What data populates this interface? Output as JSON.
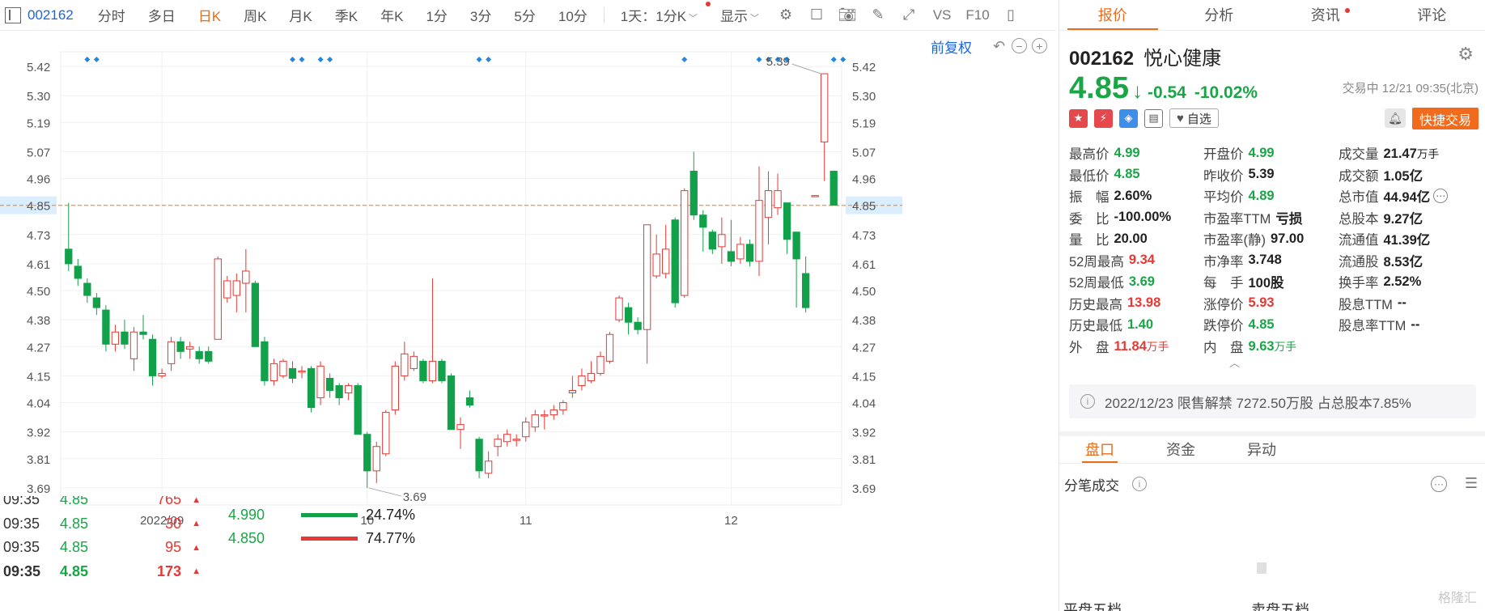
{
  "toolbar": {
    "code": "002162",
    "periods": [
      "分时",
      "多日",
      "日K",
      "周K",
      "月K",
      "季K",
      "年K",
      "1分",
      "3分",
      "5分",
      "10分"
    ],
    "active_period": "日K",
    "interval_label": "1天：1分K",
    "display_label": "显示",
    "vs_label": "VS",
    "f10_label": "F10"
  },
  "chart": {
    "adjust_label": "前复权",
    "current_price_label": "4.85",
    "max_label": "5.39",
    "min_label": "3.69",
    "x_labels": [
      "2022/09",
      "10",
      "11",
      "12"
    ],
    "y_ticks": [
      5.42,
      5.3,
      5.19,
      5.07,
      4.96,
      4.85,
      4.73,
      4.61,
      4.5,
      4.38,
      4.27,
      4.15,
      4.04,
      3.92,
      3.81,
      3.69
    ],
    "y_tick_labels": [
      "5.42",
      "5.30",
      "5.19",
      "5.07",
      "4.96",
      "4.85",
      "4.73",
      "4.61",
      "4.50",
      "4.38",
      "4.27",
      "4.15",
      "4.04",
      "3.92",
      "3.81",
      "3.69"
    ],
    "colors": {
      "up": "#e53935",
      "down": "#12a14a",
      "marker": "#1e88e5",
      "price_line": "#f59a5a"
    }
  },
  "chart_data": {
    "type": "candlestick",
    "title": "",
    "xlabel": "",
    "ylabel": "",
    "ylim": [
      3.62,
      5.48
    ],
    "x": [
      "2022/09",
      "10",
      "11",
      "12"
    ],
    "candles": [
      {
        "o": 4.67,
        "c": 4.61,
        "h": 4.86,
        "l": 4.58
      },
      {
        "o": 4.6,
        "c": 4.55,
        "h": 4.63,
        "l": 4.52
      },
      {
        "o": 4.53,
        "c": 4.48,
        "h": 4.55,
        "l": 4.45
      },
      {
        "o": 4.47,
        "c": 4.43,
        "h": 4.49,
        "l": 4.4
      },
      {
        "o": 4.42,
        "c": 4.28,
        "h": 4.44,
        "l": 4.25
      },
      {
        "o": 4.28,
        "c": 4.33,
        "h": 4.36,
        "l": 4.25
      },
      {
        "o": 4.33,
        "c": 4.28,
        "h": 4.38,
        "l": 4.26
      },
      {
        "o": 4.22,
        "c": 4.33,
        "h": 4.35,
        "l": 4.17
      },
      {
        "o": 4.33,
        "c": 4.32,
        "h": 4.4,
        "l": 4.3
      },
      {
        "o": 4.3,
        "c": 4.15,
        "h": 4.32,
        "l": 4.11
      },
      {
        "o": 4.15,
        "c": 4.16,
        "h": 4.18,
        "l": 4.14
      },
      {
        "o": 4.2,
        "c": 4.29,
        "h": 4.31,
        "l": 4.17
      },
      {
        "o": 4.29,
        "c": 4.25,
        "h": 4.31,
        "l": 4.22
      },
      {
        "o": 4.26,
        "c": 4.27,
        "h": 4.29,
        "l": 4.22
      },
      {
        "o": 4.25,
        "c": 4.22,
        "h": 4.27,
        "l": 4.2
      },
      {
        "o": 4.25,
        "c": 4.21,
        "h": 4.27,
        "l": 4.2
      },
      {
        "o": 4.3,
        "c": 4.63,
        "h": 4.64,
        "l": 4.3
      },
      {
        "o": 4.47,
        "c": 4.54,
        "h": 4.56,
        "l": 4.45
      },
      {
        "o": 4.48,
        "c": 4.54,
        "h": 4.57,
        "l": 4.41
      },
      {
        "o": 4.53,
        "c": 4.58,
        "h": 4.67,
        "l": 4.41
      },
      {
        "o": 4.53,
        "c": 4.27,
        "h": 4.54,
        "l": 4.27
      },
      {
        "o": 4.29,
        "c": 4.13,
        "h": 4.31,
        "l": 4.11
      },
      {
        "o": 4.13,
        "c": 4.2,
        "h": 4.22,
        "l": 4.11
      },
      {
        "o": 4.15,
        "c": 4.21,
        "h": 4.22,
        "l": 4.14
      },
      {
        "o": 4.18,
        "c": 4.14,
        "h": 4.21,
        "l": 4.12
      },
      {
        "o": 4.17,
        "c": 4.17,
        "h": 4.19,
        "l": 4.14
      },
      {
        "o": 4.18,
        "c": 4.02,
        "h": 4.19,
        "l": 4.0
      },
      {
        "o": 4.06,
        "c": 4.19,
        "h": 4.21,
        "l": 4.03
      },
      {
        "o": 4.14,
        "c": 4.09,
        "h": 4.16,
        "l": 4.06
      },
      {
        "o": 4.11,
        "c": 4.06,
        "h": 4.12,
        "l": 4.03
      },
      {
        "o": 4.08,
        "c": 4.11,
        "h": 4.12,
        "l": 4.05
      },
      {
        "o": 4.11,
        "c": 3.91,
        "h": 4.12,
        "l": 3.91
      },
      {
        "o": 3.91,
        "c": 3.76,
        "h": 3.92,
        "l": 3.69
      },
      {
        "o": 3.76,
        "c": 3.86,
        "h": 3.88,
        "l": 3.71
      },
      {
        "o": 3.83,
        "c": 4.0,
        "h": 4.01,
        "l": 3.82
      },
      {
        "o": 4.01,
        "c": 4.19,
        "h": 4.21,
        "l": 3.99
      },
      {
        "o": 4.15,
        "c": 4.24,
        "h": 4.29,
        "l": 4.13
      },
      {
        "o": 4.18,
        "c": 4.23,
        "h": 4.25,
        "l": 4.17
      },
      {
        "o": 4.21,
        "c": 4.13,
        "h": 4.22,
        "l": 4.12
      },
      {
        "o": 4.13,
        "c": 4.21,
        "h": 4.55,
        "l": 4.12
      },
      {
        "o": 4.21,
        "c": 4.13,
        "h": 4.22,
        "l": 4.12
      },
      {
        "o": 4.15,
        "c": 3.93,
        "h": 4.16,
        "l": 3.93
      },
      {
        "o": 3.93,
        "c": 3.95,
        "h": 3.98,
        "l": 3.85
      },
      {
        "o": 4.06,
        "c": 4.03,
        "h": 4.09,
        "l": 4.02
      },
      {
        "o": 3.89,
        "c": 3.76,
        "h": 3.9,
        "l": 3.73
      },
      {
        "o": 3.75,
        "c": 3.8,
        "h": 3.84,
        "l": 3.73
      },
      {
        "o": 3.86,
        "c": 3.89,
        "h": 3.91,
        "l": 3.82
      },
      {
        "o": 3.88,
        "c": 3.91,
        "h": 3.93,
        "l": 3.86
      },
      {
        "o": 3.89,
        "c": 3.89,
        "h": 3.91,
        "l": 3.86
      },
      {
        "o": 3.9,
        "c": 3.96,
        "h": 3.98,
        "l": 3.88
      },
      {
        "o": 3.94,
        "c": 3.99,
        "h": 4.01,
        "l": 3.92
      },
      {
        "o": 3.99,
        "c": 3.99,
        "h": 4.01,
        "l": 3.93
      },
      {
        "o": 3.99,
        "c": 4.01,
        "h": 4.03,
        "l": 3.97
      },
      {
        "o": 4.01,
        "c": 4.04,
        "h": 4.05,
        "l": 3.99
      },
      {
        "o": 4.08,
        "c": 4.09,
        "h": 4.15,
        "l": 4.06
      },
      {
        "o": 4.11,
        "c": 4.15,
        "h": 4.18,
        "l": 4.09
      },
      {
        "o": 4.13,
        "c": 4.16,
        "h": 4.21,
        "l": 4.12
      },
      {
        "o": 4.16,
        "c": 4.23,
        "h": 4.25,
        "l": 4.15
      },
      {
        "o": 4.21,
        "c": 4.32,
        "h": 4.33,
        "l": 4.2
      },
      {
        "o": 4.38,
        "c": 4.47,
        "h": 4.48,
        "l": 4.37
      },
      {
        "o": 4.43,
        "c": 4.37,
        "h": 4.45,
        "l": 4.32
      },
      {
        "o": 4.37,
        "c": 4.34,
        "h": 4.39,
        "l": 4.32
      },
      {
        "o": 4.34,
        "c": 4.77,
        "h": 4.77,
        "l": 4.2
      },
      {
        "o": 4.56,
        "c": 4.65,
        "h": 4.73,
        "l": 4.55
      },
      {
        "o": 4.57,
        "c": 4.67,
        "h": 4.77,
        "l": 4.55
      },
      {
        "o": 4.79,
        "c": 4.45,
        "h": 4.8,
        "l": 4.43
      },
      {
        "o": 4.48,
        "c": 4.91,
        "h": 4.92,
        "l": 4.47
      },
      {
        "o": 4.99,
        "c": 4.81,
        "h": 5.07,
        "l": 4.79
      },
      {
        "o": 4.81,
        "c": 4.76,
        "h": 4.83,
        "l": 4.66
      },
      {
        "o": 4.74,
        "c": 4.67,
        "h": 4.75,
        "l": 4.65
      },
      {
        "o": 4.68,
        "c": 4.73,
        "h": 4.8,
        "l": 4.61
      },
      {
        "o": 4.66,
        "c": 4.62,
        "h": 4.79,
        "l": 4.6
      },
      {
        "o": 4.63,
        "c": 4.69,
        "h": 4.72,
        "l": 4.61
      },
      {
        "o": 4.69,
        "c": 4.62,
        "h": 4.71,
        "l": 4.6
      },
      {
        "o": 4.62,
        "c": 4.87,
        "h": 5.01,
        "l": 4.56
      },
      {
        "o": 4.8,
        "c": 4.91,
        "h": 4.99,
        "l": 4.69
      },
      {
        "o": 4.84,
        "c": 4.91,
        "h": 4.98,
        "l": 4.81
      },
      {
        "o": 4.86,
        "c": 4.71,
        "h": 4.86,
        "l": 4.65
      },
      {
        "o": 4.74,
        "c": 4.63,
        "h": 4.74,
        "l": 4.43
      },
      {
        "o": 4.57,
        "c": 4.43,
        "h": 4.64,
        "l": 4.41
      },
      {
        "o": 4.89,
        "c": 4.89,
        "h": 4.89,
        "l": 4.89
      },
      {
        "o": 5.11,
        "c": 5.39,
        "h": 5.39,
        "l": 4.95
      },
      {
        "o": 4.99,
        "c": 4.85,
        "h": 4.99,
        "l": 4.85
      }
    ],
    "markers": [
      2,
      3,
      24,
      25,
      27,
      28,
      44,
      45,
      66,
      74,
      75,
      76,
      77,
      82,
      83
    ]
  },
  "panel": {
    "tabs": [
      "报价",
      "分析",
      "资讯",
      "评论"
    ],
    "code": "002162",
    "name": "悦心健康",
    "price": "4.85",
    "arrow": "↓",
    "change": "-0.54",
    "change_pct": "-10.02%",
    "status": "交易中 12/21 09:35(北京)",
    "follow": "自选",
    "quick_trade": "快捷交易",
    "stats": [
      [
        {
          "k": "最高价",
          "v": "4.99",
          "c": "green"
        },
        {
          "k": "开盘价",
          "v": "4.99",
          "c": "green"
        },
        {
          "k": "成交量",
          "v": "21.47",
          "u": "万手",
          "c": "black"
        }
      ],
      [
        {
          "k": "最低价",
          "v": "4.85",
          "c": "green"
        },
        {
          "k": "昨收价",
          "v": "5.39",
          "c": "black"
        },
        {
          "k": "成交额",
          "v": "1.05亿",
          "c": "black"
        }
      ],
      [
        {
          "k": "振　幅",
          "v": "2.60%",
          "c": "black"
        },
        {
          "k": "平均价",
          "v": "4.89",
          "c": "green"
        },
        {
          "k": "总市值",
          "v": "44.94亿",
          "c": "black"
        }
      ],
      [
        {
          "k": "委　比",
          "v": "-100.00%",
          "c": "black"
        },
        {
          "k": "市盈率TTM",
          "v": "亏损",
          "c": "black"
        },
        {
          "k": "总股本",
          "v": "9.27亿",
          "c": "black"
        }
      ],
      [
        {
          "k": "量　比",
          "v": "20.00",
          "c": "black"
        },
        {
          "k": "市盈率(静)",
          "v": "97.00",
          "c": "black"
        },
        {
          "k": "流通值",
          "v": "41.39亿",
          "c": "black"
        }
      ],
      [
        {
          "k": "52周最高",
          "v": "9.34",
          "c": "red"
        },
        {
          "k": "市净率",
          "v": "3.748",
          "c": "black"
        },
        {
          "k": "流通股",
          "v": "8.53亿",
          "c": "black"
        }
      ],
      [
        {
          "k": "52周最低",
          "v": "3.69",
          "c": "green"
        },
        {
          "k": "每　手",
          "v": "100股",
          "c": "black"
        },
        {
          "k": "换手率",
          "v": "2.52%",
          "c": "black"
        }
      ],
      [
        {
          "k": "历史最高",
          "v": "13.98",
          "c": "red"
        },
        {
          "k": "涨停价",
          "v": "5.93",
          "c": "red"
        },
        {
          "k": "股息TTM",
          "v": "--",
          "c": "black"
        }
      ],
      [
        {
          "k": "历史最低",
          "v": "1.40",
          "c": "green"
        },
        {
          "k": "跌停价",
          "v": "4.85",
          "c": "green"
        },
        {
          "k": "股息率TTM",
          "v": "--",
          "c": "black"
        }
      ],
      [
        {
          "k": "外　盘",
          "v": "11.84",
          "u": "万手",
          "c": "red"
        },
        {
          "k": "内　盘",
          "v": "9.63",
          "u": "万手",
          "c": "green"
        },
        {
          "k": "",
          "v": "",
          "c": "black"
        }
      ]
    ],
    "notice": "2022/12/23  限售解禁 7272.50万股 占总股本7.85%",
    "subtabs": [
      "盘口",
      "资金",
      "异动"
    ],
    "ticks_title": "分笔成交",
    "ticks": [
      {
        "t": "09:35",
        "p": "4.85",
        "v": "765"
      },
      {
        "t": "09:35",
        "p": "4.85",
        "v": "30"
      },
      {
        "t": "09:35",
        "p": "4.85",
        "v": "95"
      },
      {
        "t": "09:35",
        "p": "4.85",
        "v": "173"
      }
    ],
    "dist": [
      {
        "p": "4.990",
        "pct": "24.74%",
        "color": "#12a14a"
      },
      {
        "p": "4.850",
        "pct": "74.77%",
        "color": "#e53935"
      }
    ],
    "bottom": [
      "平盘五档",
      "卖盘五档"
    ],
    "watermark": "格隆汇"
  }
}
